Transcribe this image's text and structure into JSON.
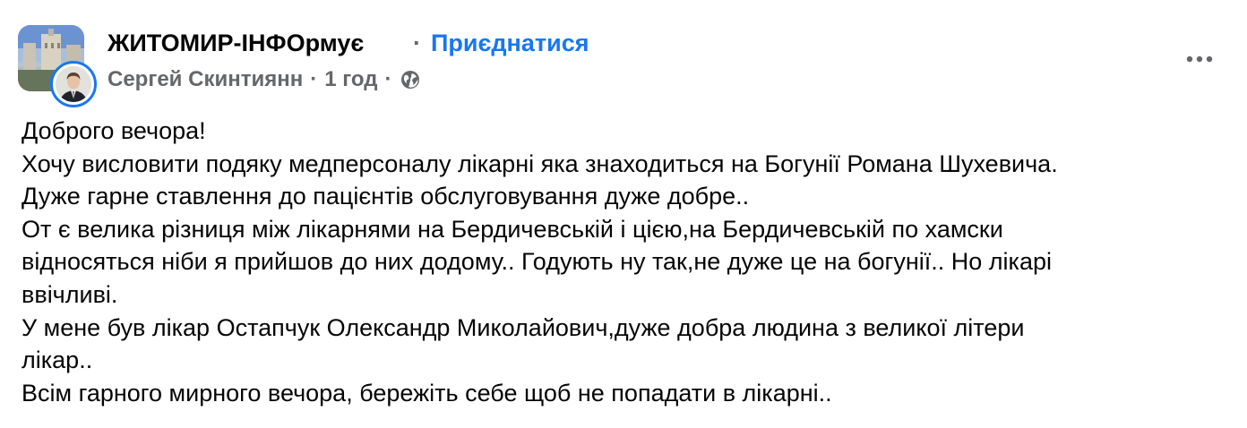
{
  "post": {
    "group_name": "ЖИТОМИР-ІНФОрмує",
    "separator": "·",
    "join_label": "Приєднатися",
    "author": "Сергей Скинтиянн",
    "time": "1 год",
    "privacy_icon": "globe-icon",
    "more_icon": "more-horizontal-icon",
    "colors": {
      "link": "#1877f2",
      "secondary_text": "#65676b",
      "primary_text": "#050505"
    },
    "body_lines": [
      "Доброго вечора!",
      "Хочу висловити подяку медперсоналу лікарні яка знаходиться на Богунії Романа Шухевича.",
      "Дуже гарне ставлення до пацієнтів обслуговування дуже добре..",
      "От є велика різниця між лікарнями на Бердичевській і цією,на Бердичевській по хамски",
      "відносяться ніби я прийшов до них додому.. Годують ну так,не дуже це на богунії.. Но лікарі",
      "ввічливі.",
      "У мене був лікар Остапчук Олександр Миколайович,дуже добра людина з великої літери",
      "лікар..",
      "Всім гарного мирного вечора, бережіть себе щоб не попадати в лікарні.."
    ]
  }
}
